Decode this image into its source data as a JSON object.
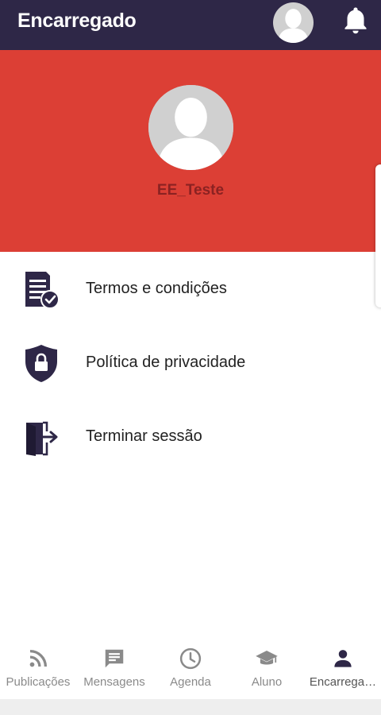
{
  "topbar": {
    "title": "Encarregado",
    "background": "#2e2747",
    "avatar_icon": "user-silhouette-icon",
    "bell_icon": "bell-icon"
  },
  "profile": {
    "name": "EE_Teste",
    "background": "#dc3f35",
    "name_color": "#8b2222",
    "avatar_icon": "user-silhouette-icon"
  },
  "menu": {
    "icon_color": "#2e2747",
    "items": [
      {
        "label": "Termos e condições",
        "icon": "document-check-icon"
      },
      {
        "label": "Política de privacidade",
        "icon": "shield-lock-icon"
      },
      {
        "label": "Terminar sessão",
        "icon": "logout-door-icon"
      }
    ]
  },
  "bottom_nav": {
    "inactive_color": "#8a8a8a",
    "active_color": "#2e2747",
    "active_index": 4,
    "items": [
      {
        "label": "Publicações",
        "icon": "rss-icon"
      },
      {
        "label": "Mensagens",
        "icon": "message-icon"
      },
      {
        "label": "Agenda",
        "icon": "clock-icon"
      },
      {
        "label": "Aluno",
        "icon": "graduation-cap-icon"
      },
      {
        "label": "Encarrega…",
        "icon": "person-icon"
      }
    ]
  }
}
